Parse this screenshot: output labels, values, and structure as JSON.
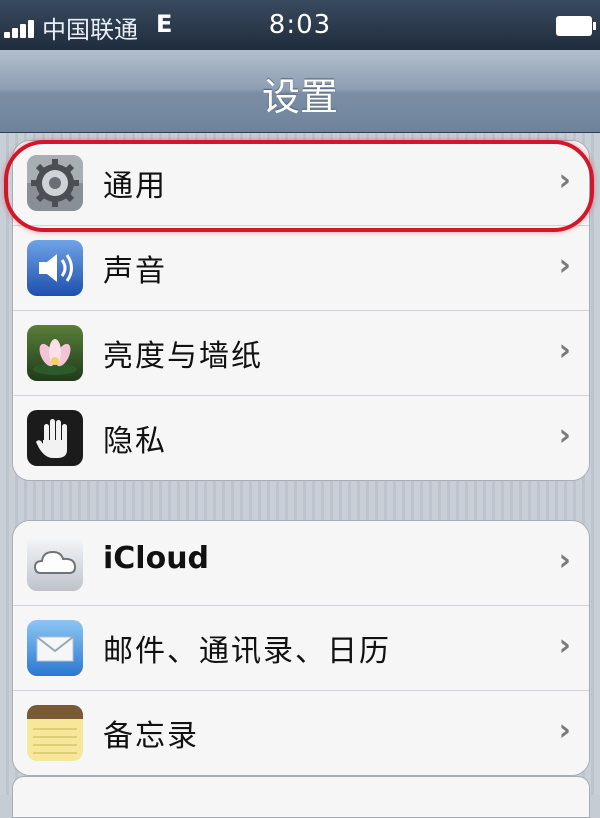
{
  "status_bar": {
    "carrier": "中国联通",
    "network": "E",
    "time": "8:03"
  },
  "navbar": {
    "title": "设置"
  },
  "groups": [
    {
      "items": [
        {
          "label": "通用",
          "icon": "gear-icon"
        },
        {
          "label": "声音",
          "icon": "speaker-icon"
        },
        {
          "label": "亮度与墙纸",
          "icon": "flower-icon"
        },
        {
          "label": "隐私",
          "icon": "hand-icon"
        }
      ]
    },
    {
      "items": [
        {
          "label": "iCloud",
          "icon": "cloud-icon"
        },
        {
          "label": "邮件、通讯录、日历",
          "icon": "mail-icon"
        },
        {
          "label": "备忘录",
          "icon": "notes-icon"
        }
      ]
    }
  ],
  "chevron": "›",
  "colors": {
    "highlight": "#d3172a",
    "nav": "#8c9eb2"
  }
}
